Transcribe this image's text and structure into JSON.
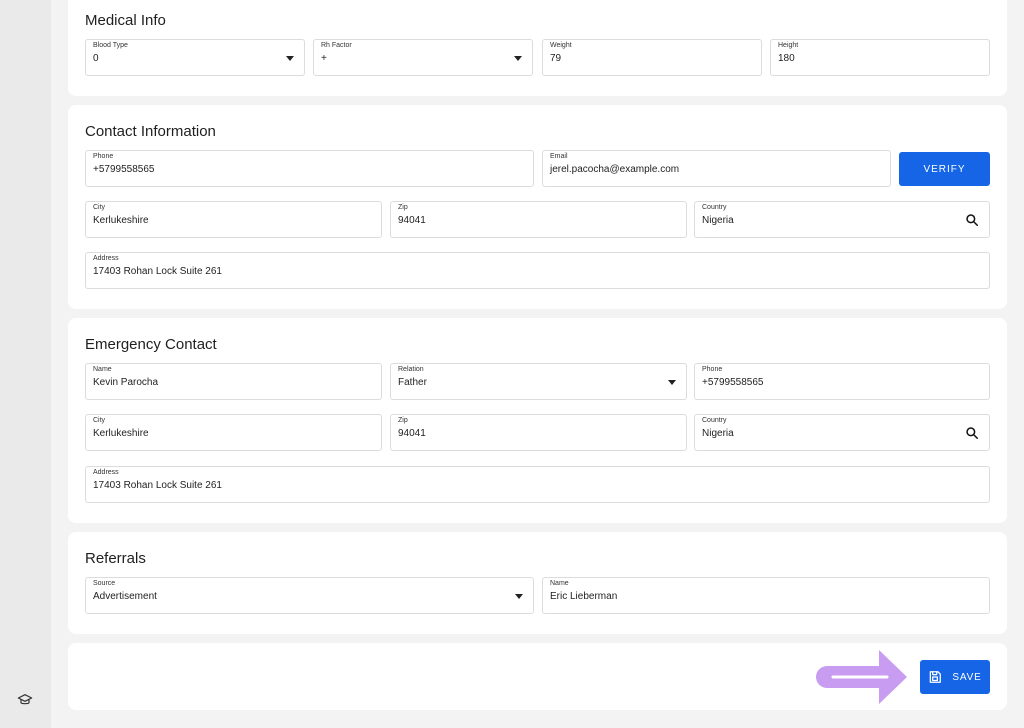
{
  "medical": {
    "title": "Medical Info",
    "blood_type": {
      "label": "Blood Type",
      "value": "0"
    },
    "rh_factor": {
      "label": "Rh Factor",
      "value": "+"
    },
    "weight": {
      "label": "Weight",
      "value": "79"
    },
    "height": {
      "label": "Height",
      "value": "180"
    }
  },
  "contact": {
    "title": "Contact Information",
    "phone": {
      "label": "Phone",
      "value": "+5799558565"
    },
    "email": {
      "label": "Email",
      "value": "jerel.pacocha@example.com"
    },
    "verify_label": "VERIFY",
    "city": {
      "label": "City",
      "value": "Kerlukeshire"
    },
    "zip": {
      "label": "Zip",
      "value": "94041"
    },
    "country": {
      "label": "Country",
      "value": "Nigeria"
    },
    "address": {
      "label": "Address",
      "value": "17403 Rohan Lock Suite 261"
    }
  },
  "emergency": {
    "title": "Emergency Contact",
    "name": {
      "label": "Name",
      "value": "Kevin Parocha"
    },
    "relation": {
      "label": "Relation",
      "value": "Father"
    },
    "phone": {
      "label": "Phone",
      "value": "+5799558565"
    },
    "city": {
      "label": "City",
      "value": "Kerlukeshire"
    },
    "zip": {
      "label": "Zip",
      "value": "94041"
    },
    "country": {
      "label": "Country",
      "value": "Nigeria"
    },
    "address": {
      "label": "Address",
      "value": "17403 Rohan Lock Suite 261"
    }
  },
  "referrals": {
    "title": "Referrals",
    "source": {
      "label": "Source",
      "value": "Advertisement"
    },
    "name": {
      "label": "Name",
      "value": "Eric Lieberman"
    }
  },
  "footer": {
    "save_label": "SAVE"
  },
  "icons": {
    "rail": "graduation-cap-icon",
    "search": "search-icon",
    "save": "floppy-disk-icon",
    "pointer": "arrow-right-icon"
  },
  "colors": {
    "primary": "#1565e6",
    "arrow": "#c89cf0"
  }
}
